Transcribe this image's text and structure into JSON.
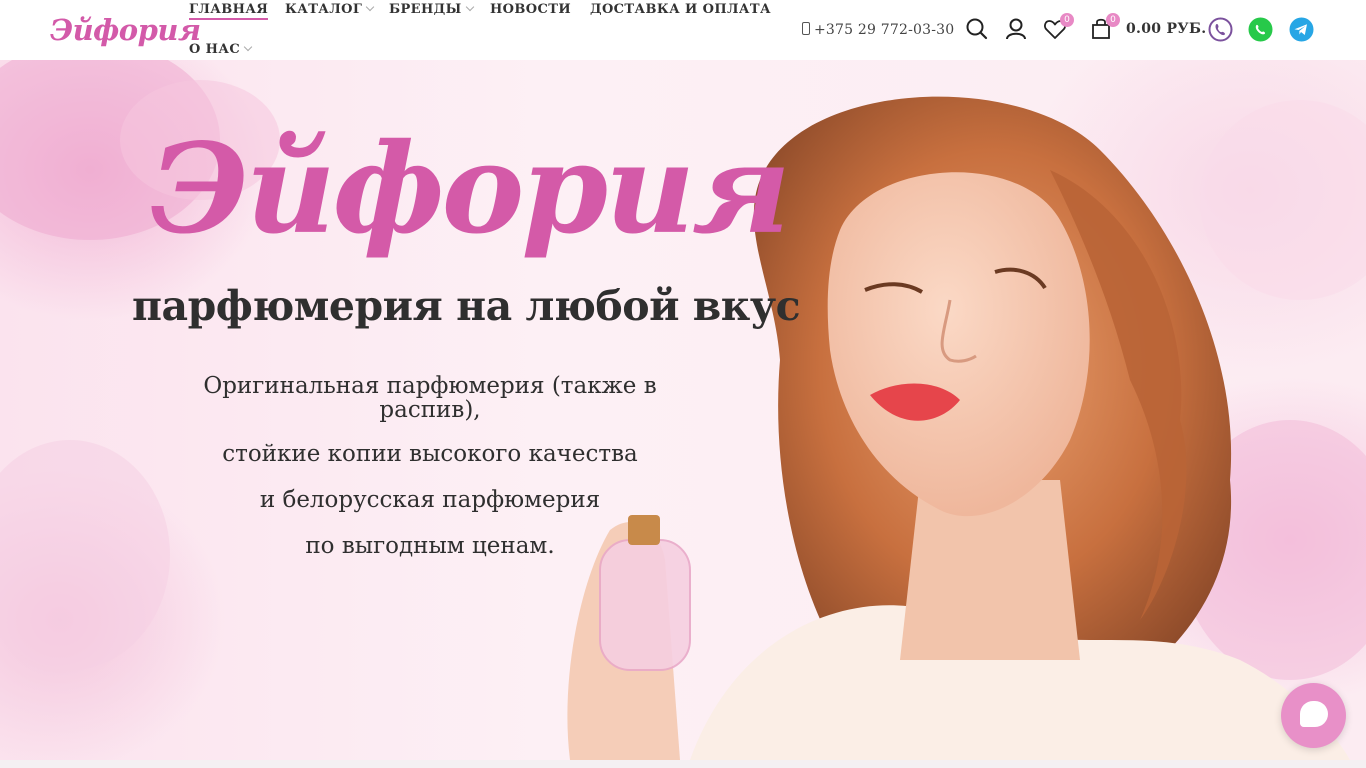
{
  "header": {
    "logo": "Эйфория",
    "nav": [
      {
        "label": "ГЛАВНАЯ",
        "active": true,
        "dropdown": false
      },
      {
        "label": "КАТАЛОГ",
        "active": false,
        "dropdown": true
      },
      {
        "label": "БРЕНДЫ",
        "active": false,
        "dropdown": true
      },
      {
        "label": "НОВОСТИ",
        "active": false,
        "dropdown": false
      },
      {
        "label": "ДОСТАВКА И ОПЛАТА",
        "active": false,
        "dropdown": false
      },
      {
        "label": "О НАС",
        "active": false,
        "dropdown": true
      }
    ],
    "phone": "+375 29 772-03-30",
    "icons": [
      "search-icon",
      "user-icon",
      "heart-icon",
      "cart-icon"
    ],
    "wishlist_count": "0",
    "cart_count": "0",
    "cart_total": "0.00 РУБ.",
    "social": [
      "viber-icon",
      "whatsapp-icon",
      "telegram-icon"
    ]
  },
  "hero": {
    "title": "Эйфория",
    "subtitle": "парфюмерия на любой вкус",
    "lines": [
      "Оригинальная парфюмерия (также в распив),",
      "стойкие копии высокого качества",
      "и белорусская парфюмерия",
      "по выгодным ценам."
    ]
  },
  "colors": {
    "brand": "#d45aa8",
    "badge": "#e889c5",
    "chat": "#e890c8"
  },
  "chat_button": {
    "icon": "chat-icon"
  }
}
